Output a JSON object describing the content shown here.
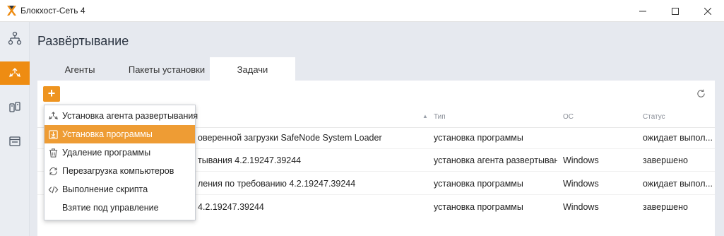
{
  "window": {
    "title": "Блокхост-Сеть 4",
    "accent_color": "#ee8c12"
  },
  "sidebar": {
    "items": [
      {
        "icon": "network-icon"
      },
      {
        "icon": "deploy-icon",
        "active": true
      },
      {
        "icon": "agents-icon"
      },
      {
        "icon": "window-icon"
      }
    ]
  },
  "page": {
    "title": "Развёртывание"
  },
  "tabs": [
    {
      "label": "Агенты"
    },
    {
      "label": "Пакеты установки"
    },
    {
      "label": "Задачи",
      "active": true
    }
  ],
  "toolbar": {
    "add_label": "+",
    "refresh_icon": "refresh-icon"
  },
  "table": {
    "columns": [
      "Тип",
      "ОС",
      "Статус"
    ],
    "rows": [
      {
        "name": "оверенной загрузки SafeNode System Loader",
        "type": "установка программы",
        "os": "",
        "status": "ожидает выпол..."
      },
      {
        "name": "тывания 4.2.19247.39244",
        "type": "установка агента развертыван...",
        "os": "Windows",
        "status": "завершено"
      },
      {
        "name": "ления по требованию 4.2.19247.39244",
        "type": "установка программы",
        "os": "Windows",
        "status": "ожидает выпол..."
      },
      {
        "name": "4.2.19247.39244",
        "type": "установка программы",
        "os": "Windows",
        "status": "завершено"
      }
    ]
  },
  "menu": {
    "items": [
      {
        "label": "Установка агента развертывания",
        "icon": "deploy-agent-icon"
      },
      {
        "label": "Установка программы",
        "icon": "install-icon",
        "selected": true
      },
      {
        "label": "Удаление программы",
        "icon": "trash-icon"
      },
      {
        "label": "Перезагрузка компьютеров",
        "icon": "restart-icon"
      },
      {
        "label": "Выполнение скрипта",
        "icon": "code-icon"
      },
      {
        "label": "Взятие под управление",
        "icon": ""
      }
    ]
  }
}
